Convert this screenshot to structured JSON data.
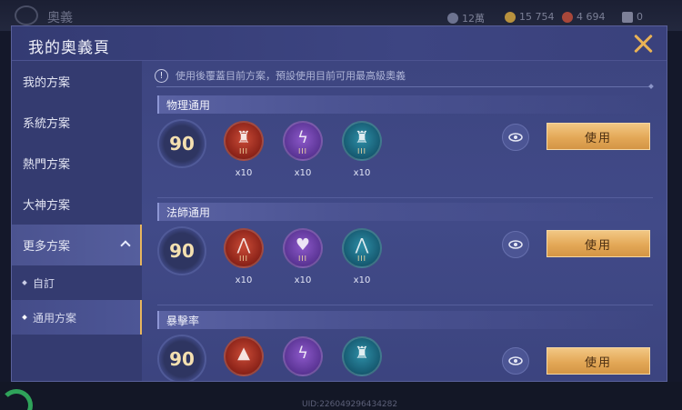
{
  "background": {
    "title": "奧義",
    "resources": [
      {
        "icon": "gem-icon",
        "value": "12萬"
      },
      {
        "icon": "gold-coin-icon",
        "value": "15 754"
      },
      {
        "icon": "diamond-icon",
        "value": "4 694"
      },
      {
        "icon": "ticket-icon",
        "value": "0"
      }
    ],
    "uid": "UID:226049296434282"
  },
  "modal": {
    "title": "我的奧義頁",
    "close_icon": "close-icon"
  },
  "sidebar": {
    "items": [
      {
        "label": "我的方案"
      },
      {
        "label": "系統方案"
      },
      {
        "label": "熱門方案"
      },
      {
        "label": "大神方案"
      },
      {
        "label": "更多方案"
      }
    ],
    "sub_items": [
      {
        "label": "自訂"
      },
      {
        "label": "通用方案"
      }
    ]
  },
  "notice": {
    "icon": "!",
    "text": "使用後覆蓋目前方案，預設使用目前可用最高級奧義"
  },
  "sections": [
    {
      "title": "物理通用",
      "level": "90",
      "emblems": [
        {
          "color": "#b8402f",
          "icon": "warrior-emblem-icon",
          "tier": "III",
          "count": "x10"
        },
        {
          "color": "#6a3ea8",
          "icon": "lightning-emblem-icon",
          "tier": "III",
          "count": "x10"
        },
        {
          "color": "#1f7590",
          "icon": "warrior-emblem-icon",
          "tier": "III",
          "count": "x10"
        }
      ],
      "use_label": "使用"
    },
    {
      "title": "法師通用",
      "level": "90",
      "emblems": [
        {
          "color": "#b8402f",
          "icon": "arch-emblem-icon",
          "tier": "III",
          "count": "x10"
        },
        {
          "color": "#6a3ea8",
          "icon": "heart-emblem-icon",
          "tier": "III",
          "count": "x10"
        },
        {
          "color": "#1f7590",
          "icon": "arch-emblem-icon",
          "tier": "III",
          "count": "x10"
        }
      ],
      "use_label": "使用"
    },
    {
      "title": "暴擊率",
      "level": "90",
      "emblems": [
        {
          "color": "#b8402f",
          "icon": "flame-emblem-icon",
          "tier": "",
          "count": ""
        },
        {
          "color": "#6a3ea8",
          "icon": "lightning-emblem-icon",
          "tier": "",
          "count": ""
        },
        {
          "color": "#1f7590",
          "icon": "warrior-emblem-icon",
          "tier": "",
          "count": ""
        }
      ],
      "use_label": "使用"
    }
  ],
  "colors": {
    "accent_gold": "#e8b65d",
    "panel": "#3a4178"
  }
}
